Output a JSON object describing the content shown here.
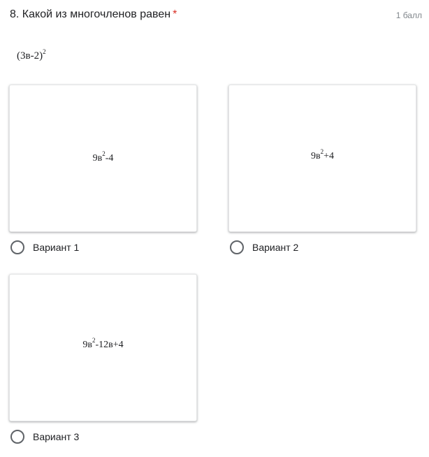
{
  "question": {
    "title": "8. Какой из многочленов равен",
    "required_marker": "*",
    "points": "1 балл",
    "expression": {
      "base": "(3в-2)",
      "exponent": "2"
    }
  },
  "options": [
    {
      "label": "Вариант 1",
      "formula": {
        "pre": "9в",
        "sup": "2",
        "post": "-4"
      },
      "selected": false
    },
    {
      "label": "Вариант 2",
      "formula": {
        "pre": "9в",
        "sup": "2",
        "post": "+4"
      },
      "selected": false
    },
    {
      "label": "Вариант 3",
      "formula": {
        "pre": "9в",
        "sup": "2",
        "post": "-12в+4"
      },
      "selected": false
    }
  ],
  "colors": {
    "required": "#d93025",
    "points_text": "#80868b",
    "radio_border": "#5f6368"
  }
}
